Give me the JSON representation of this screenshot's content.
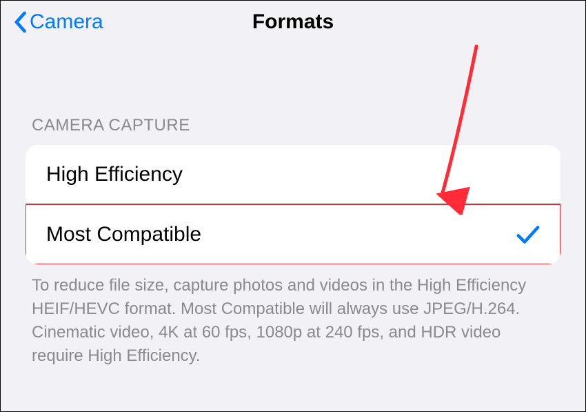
{
  "header": {
    "back_label": "Camera",
    "title": "Formats"
  },
  "section": {
    "label": "CAMERA CAPTURE",
    "options": [
      {
        "label": "High Efficiency",
        "selected": false
      },
      {
        "label": "Most Compatible",
        "selected": true
      }
    ]
  },
  "footer": {
    "text": "To reduce file size, capture photos and videos in the High Efficiency HEIF/HEVC format. Most Compatible will always use JPEG/H.264. Cinematic video, 4K at 60 fps, 1080p at 240 fps, and HDR video require High Efficiency."
  },
  "annotation": {
    "arrow_color": "#ff2b36",
    "highlight_color": "#d7303d"
  }
}
